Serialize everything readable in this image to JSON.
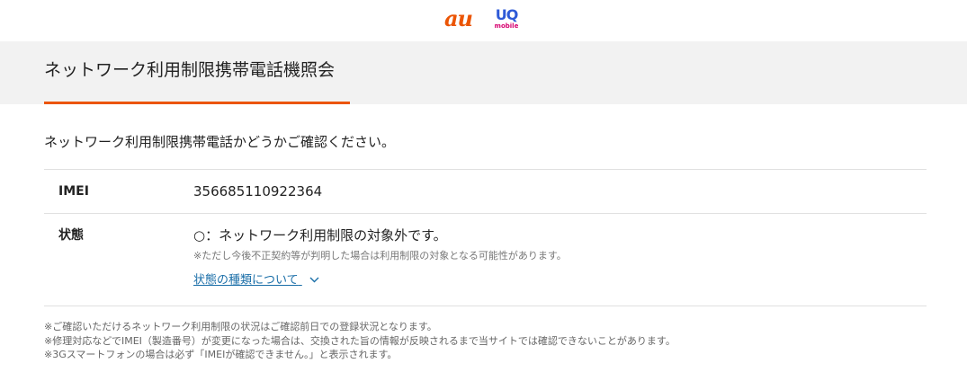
{
  "header": {
    "logo_au": "au",
    "logo_uq_main": "UQ",
    "logo_uq_sub": "mobile"
  },
  "page": {
    "title": "ネットワーク利用制限携帯電話機照会",
    "intro": "ネットワーク利用制限携帯電話かどうかご確認ください。"
  },
  "result": {
    "imei_label": "IMEI",
    "imei_value": "356685110922364",
    "status_label": "状態",
    "status_value": "○：ネットワーク利用制限の対象外です。",
    "status_note": "※ただし今後不正契約等が判明した場合は利用制限の対象となる可能性があります。",
    "status_link": "状態の種類について"
  },
  "footnotes": [
    "※ご確認いただけるネットワーク利用制限の状況はご確認前日での登録状況となります。",
    "※修理対応などでIMEI（製造番号）が変更になった場合は、交換された旨の情報が反映されるまで当サイトでは確認できないことがあります。",
    "※3Gスマートフォンの場合は必ず「IMEIが確認できません。」と表示されます。"
  ],
  "colors": {
    "accent": "#eb5505",
    "link": "#1a6ea8",
    "uq_blue": "#2e5ad7",
    "uq_pink": "#d6006f"
  }
}
